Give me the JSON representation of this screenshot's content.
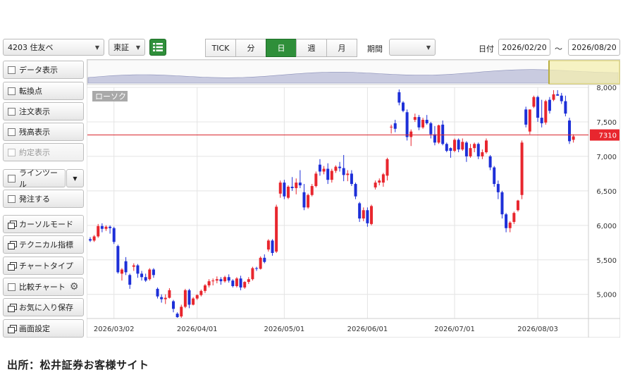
{
  "toolbar": {
    "symbol": "4203 住友ベ",
    "market": "東証",
    "timeframes": [
      "TICK",
      "分",
      "日",
      "週",
      "月"
    ],
    "active_timeframe": "日",
    "period_label": "期間",
    "period_value": "",
    "date_label": "日付",
    "date_from": "2026/02/20",
    "date_sep": "〜",
    "date_to": "2026/08/20"
  },
  "sidebar": {
    "items": [
      {
        "label": "データ表示",
        "kind": "check"
      },
      {
        "label": "転換点",
        "kind": "check"
      },
      {
        "label": "注文表示",
        "kind": "check"
      },
      {
        "label": "残高表示",
        "kind": "check"
      },
      {
        "label": "約定表示",
        "kind": "check",
        "disabled": true
      },
      {
        "label": "ラインツール",
        "kind": "check"
      },
      {
        "label": "発注する",
        "kind": "check"
      },
      {
        "label": "カーソルモード",
        "kind": "window"
      },
      {
        "label": "テクニカル指標",
        "kind": "window"
      },
      {
        "label": "チャートタイプ",
        "kind": "window"
      },
      {
        "label": "比較チャート",
        "kind": "check"
      },
      {
        "label": "お気に入り保存",
        "kind": "window"
      },
      {
        "label": "画面設定",
        "kind": "window"
      }
    ]
  },
  "chart_data": {
    "type": "candlestick",
    "series_label": "ローソク",
    "y_ticks": [
      "8,000",
      "7,500",
      "7,000",
      "6,500",
      "6,000",
      "5,500",
      "5,000"
    ],
    "ylim": [
      4650,
      8000
    ],
    "x_tick_labels": [
      "2026/03/02",
      "2026/04/01",
      "2026/05/01",
      "2026/06/01",
      "2026/07/01",
      "2026/08/03"
    ],
    "x_tick_index": [
      6,
      27,
      49,
      70,
      92,
      113
    ],
    "current_price": 7310,
    "current_price_label": "7310",
    "up_color": "#e8262e",
    "down_color": "#1d2fd8",
    "candles": [
      [
        5800,
        5830,
        5760,
        5780
      ],
      [
        5780,
        5860,
        5760,
        5840
      ],
      [
        5840,
        6020,
        5820,
        5990
      ],
      [
        5990,
        6030,
        5900,
        5950
      ],
      [
        5950,
        6000,
        5920,
        5980
      ],
      [
        5980,
        6000,
        5880,
        5960
      ],
      [
        5960,
        5980,
        5730,
        5760
      ],
      [
        5700,
        5720,
        5300,
        5320
      ],
      [
        5300,
        5380,
        5200,
        5360
      ],
      [
        5480,
        5540,
        5280,
        5320
      ],
      [
        5280,
        5300,
        5080,
        5140
      ],
      [
        5400,
        5450,
        5340,
        5420
      ],
      [
        5420,
        5440,
        5240,
        5300
      ],
      [
        5300,
        5340,
        5200,
        5250
      ],
      [
        5250,
        5300,
        5180,
        5200
      ],
      [
        5220,
        5380,
        5200,
        5360
      ],
      [
        5360,
        5380,
        5240,
        5280
      ],
      [
        5080,
        5100,
        4940,
        4970
      ],
      [
        4960,
        5000,
        4880,
        4930
      ],
      [
        4930,
        5000,
        4860,
        4950
      ],
      [
        4950,
        5090,
        4940,
        5060
      ],
      [
        4900,
        4920,
        4740,
        4790
      ],
      [
        4720,
        4740,
        4660,
        4670
      ],
      [
        4680,
        4850,
        4660,
        4820
      ],
      [
        4820,
        5080,
        4800,
        5060
      ],
      [
        5060,
        5080,
        4800,
        4850
      ],
      [
        4850,
        4960,
        4840,
        4940
      ],
      [
        4940,
        5000,
        4920,
        4990
      ],
      [
        4990,
        5070,
        4970,
        5050
      ],
      [
        5050,
        5150,
        5020,
        5130
      ],
      [
        5130,
        5220,
        5100,
        5190
      ],
      [
        5190,
        5230,
        5130,
        5200
      ],
      [
        5200,
        5260,
        5160,
        5220
      ],
      [
        5220,
        5250,
        5140,
        5190
      ],
      [
        5190,
        5270,
        5170,
        5250
      ],
      [
        5250,
        5290,
        5170,
        5200
      ],
      [
        5200,
        5220,
        5100,
        5120
      ],
      [
        5120,
        5250,
        5100,
        5230
      ],
      [
        5230,
        5270,
        5060,
        5100
      ],
      [
        5100,
        5190,
        5080,
        5180
      ],
      [
        5180,
        5250,
        5150,
        5220
      ],
      [
        5220,
        5400,
        5200,
        5380
      ],
      [
        5380,
        5400,
        5340,
        5370
      ],
      [
        5370,
        5550,
        5360,
        5530
      ],
      [
        5530,
        5580,
        5450,
        5470
      ],
      [
        5650,
        5800,
        5620,
        5780
      ],
      [
        5780,
        5800,
        5560,
        5600
      ],
      [
        5620,
        6300,
        5600,
        6270
      ],
      [
        6460,
        6650,
        6400,
        6620
      ],
      [
        6620,
        6660,
        6380,
        6420
      ],
      [
        6400,
        6580,
        6380,
        6560
      ],
      [
        6560,
        6700,
        6500,
        6540
      ],
      [
        6540,
        6680,
        6450,
        6620
      ],
      [
        6620,
        6800,
        6540,
        6580
      ],
      [
        6480,
        6600,
        6220,
        6260
      ],
      [
        6260,
        6460,
        6240,
        6440
      ],
      [
        6440,
        6600,
        6420,
        6570
      ],
      [
        6570,
        6780,
        6550,
        6750
      ],
      [
        6880,
        6960,
        6720,
        6780
      ],
      [
        6780,
        6860,
        6740,
        6820
      ],
      [
        6820,
        6900,
        6600,
        6660
      ],
      [
        6660,
        6820,
        6620,
        6790
      ],
      [
        6790,
        6870,
        6760,
        6850
      ],
      [
        6850,
        6920,
        6780,
        6830
      ],
      [
        6830,
        7020,
        6640,
        6730
      ],
      [
        6730,
        6800,
        6640,
        6750
      ],
      [
        6750,
        6800,
        6570,
        6600
      ],
      [
        6600,
        6620,
        6380,
        6420
      ],
      [
        6320,
        6340,
        6050,
        6100
      ],
      [
        6100,
        6260,
        6060,
        6220
      ],
      [
        6220,
        6260,
        5980,
        6030
      ],
      [
        6020,
        6300,
        6000,
        6280
      ],
      [
        6550,
        6650,
        6520,
        6620
      ],
      [
        6620,
        6680,
        6580,
        6650
      ],
      [
        6620,
        6760,
        6560,
        6740
      ],
      [
        6720,
        6980,
        6650,
        6960
      ],
      [
        7420,
        7460,
        7330,
        7430
      ],
      [
        7480,
        7530,
        7350,
        7400
      ],
      [
        7930,
        7970,
        7740,
        7780
      ],
      [
        7780,
        7800,
        7640,
        7660
      ],
      [
        7640,
        7680,
        7230,
        7280
      ],
      [
        7280,
        7390,
        7150,
        7360
      ],
      [
        7530,
        7620,
        7500,
        7570
      ],
      [
        7570,
        7600,
        7380,
        7420
      ],
      [
        7420,
        7560,
        7400,
        7530
      ],
      [
        7530,
        7600,
        7460,
        7480
      ],
      [
        7480,
        7500,
        7260,
        7320
      ],
      [
        7320,
        7440,
        7160,
        7200
      ],
      [
        7200,
        7460,
        7180,
        7450
      ],
      [
        7460,
        7520,
        7160,
        7180
      ],
      [
        7180,
        7200,
        7060,
        7080
      ],
      [
        7120,
        7130,
        6980,
        7080
      ],
      [
        7080,
        7260,
        7060,
        7240
      ],
      [
        7240,
        7260,
        7060,
        7100
      ],
      [
        7100,
        7260,
        7080,
        7210
      ],
      [
        7200,
        7220,
        6920,
        7000
      ],
      [
        7000,
        7180,
        6980,
        7120
      ],
      [
        7120,
        7200,
        7060,
        7180
      ],
      [
        7180,
        7200,
        6960,
        7000
      ],
      [
        7000,
        7100,
        6960,
        7060
      ],
      [
        7060,
        7260,
        7040,
        7230
      ],
      [
        7000,
        7020,
        6800,
        6840
      ],
      [
        6840,
        6860,
        6560,
        6600
      ],
      [
        6600,
        6650,
        6380,
        6480
      ],
      [
        6480,
        6500,
        6100,
        6160
      ],
      [
        6160,
        6180,
        5900,
        5960
      ],
      [
        5960,
        6060,
        5900,
        6040
      ],
      [
        6050,
        6200,
        6020,
        6180
      ],
      [
        6220,
        6370,
        6200,
        6360
      ],
      [
        6440,
        7230,
        6380,
        7200
      ],
      [
        7680,
        7720,
        7420,
        7460
      ],
      [
        7360,
        7680,
        7320,
        7680
      ],
      [
        7720,
        7880,
        7700,
        7860
      ],
      [
        7860,
        7880,
        7500,
        7560
      ],
      [
        7560,
        7820,
        7420,
        7480
      ],
      [
        7490,
        7820,
        7460,
        7800
      ],
      [
        7820,
        7860,
        7620,
        7660
      ],
      [
        7820,
        7960,
        7800,
        7900
      ],
      [
        7900,
        7960,
        7880,
        7880
      ],
      [
        7880,
        7920,
        7760,
        7800
      ],
      [
        7800,
        7880,
        7580,
        7620
      ],
      [
        7520,
        7560,
        7180,
        7220
      ],
      [
        7240,
        7320,
        7200,
        7290
      ]
    ]
  }
}
